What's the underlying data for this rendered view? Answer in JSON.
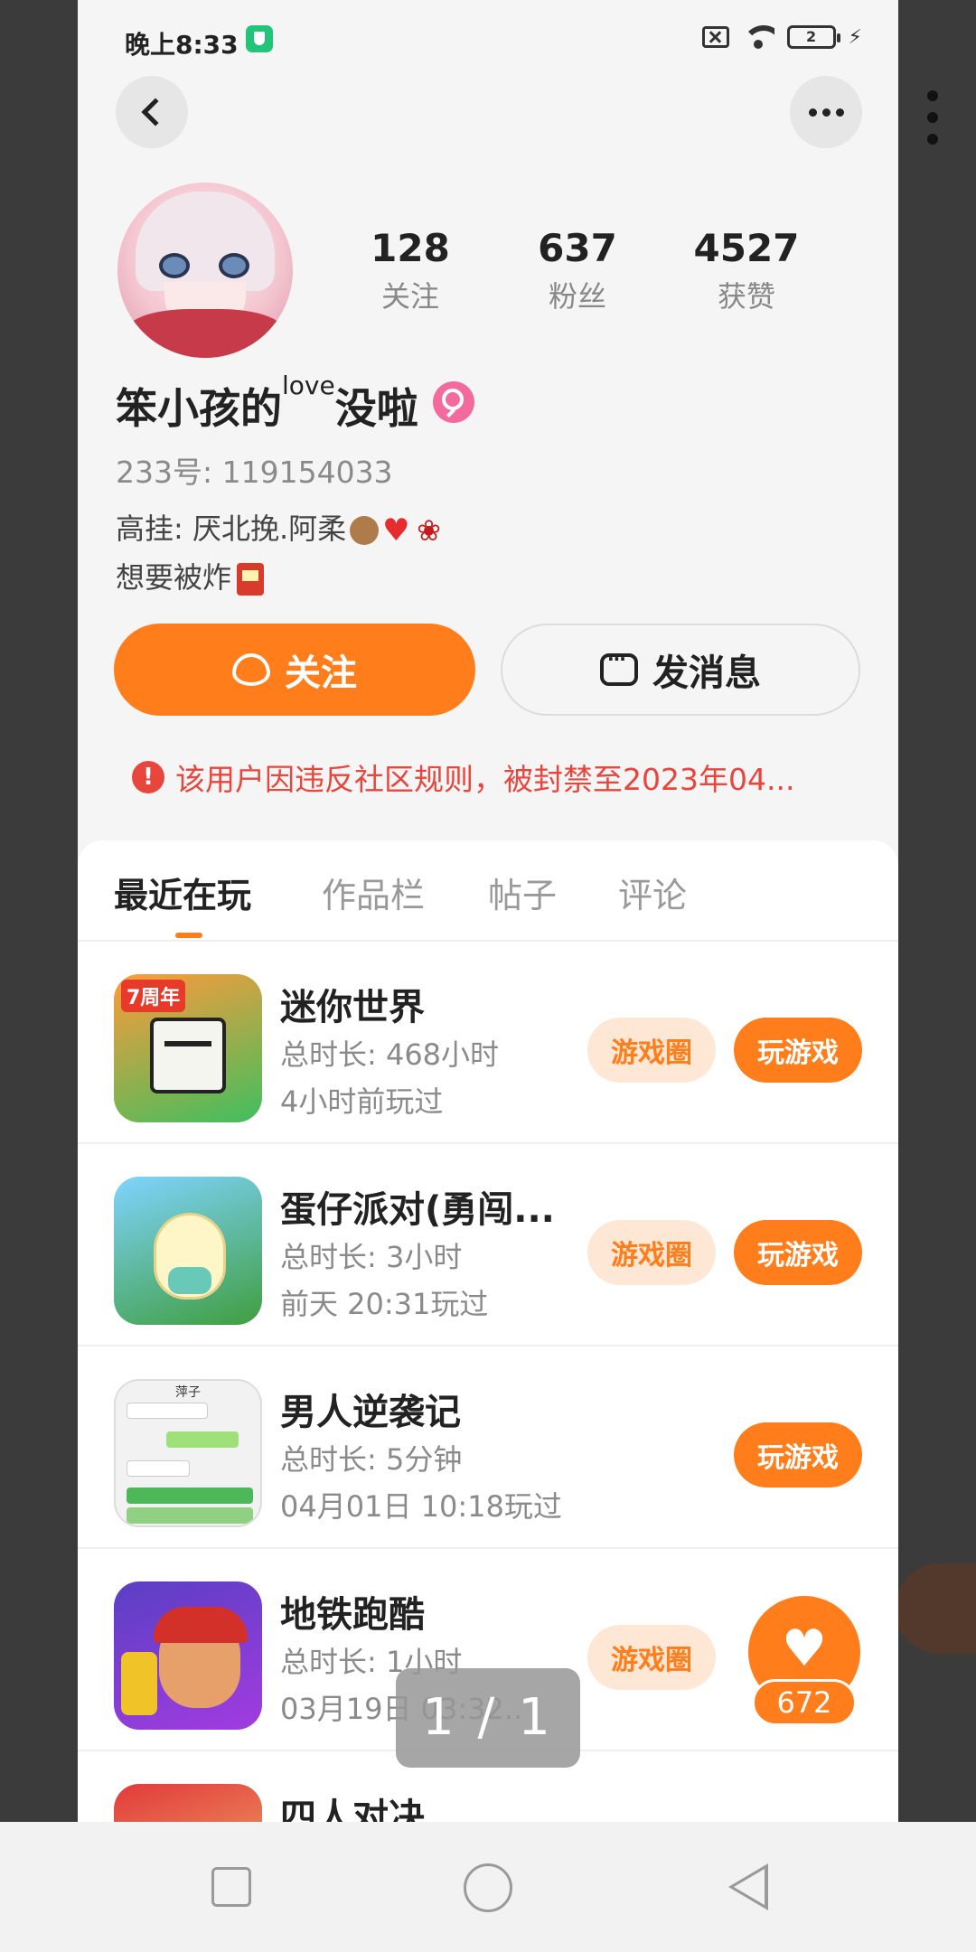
{
  "status_bar": {
    "time": "晚上8:33",
    "battery": "2"
  },
  "profile": {
    "stats": [
      {
        "num": "128",
        "label": "关注"
      },
      {
        "num": "637",
        "label": "粉丝"
      },
      {
        "num": "4527",
        "label": "获赞"
      }
    ],
    "nickname_main": "笨小孩的",
    "nickname_sup": "love",
    "nickname_end": "没啦",
    "uid": "233号: 119154033",
    "bio_line1": "高挂: 厌北挽.阿柔",
    "bio_line2": "想要被炸"
  },
  "actions": {
    "follow_label": "关注",
    "message_label": "发消息"
  },
  "ban_notice": "该用户因违反社区规则，被封禁至2023年04...",
  "tabs": [
    "最近在玩",
    "作品栏",
    "帖子",
    "评论"
  ],
  "games": [
    {
      "name": "迷你世界",
      "duration": "总时长: 468小时",
      "last_played": "4小时前玩过",
      "circle_label": "游戏圈",
      "play_label": "玩游戏"
    },
    {
      "name": "蛋仔派对(勇闯...",
      "duration": "总时长: 3小时",
      "last_played": "前天 20:31玩过",
      "circle_label": "游戏圈",
      "play_label": "玩游戏"
    },
    {
      "name": "男人逆袭记",
      "duration": "总时长: 5分钟",
      "last_played": "04月01日 10:18玩过",
      "play_label": "玩游戏"
    },
    {
      "name": "地铁跑酷",
      "duration": "总时长: 1小时",
      "last_played": "03月19日 03:32..",
      "circle_label": "游戏圈"
    },
    {
      "name": "四人对决"
    }
  ],
  "pager": "1 / 1",
  "likes": "672",
  "colors": {
    "accent": "#ff7d1a",
    "warning": "#e8453c",
    "gender": "#f36b9c"
  }
}
